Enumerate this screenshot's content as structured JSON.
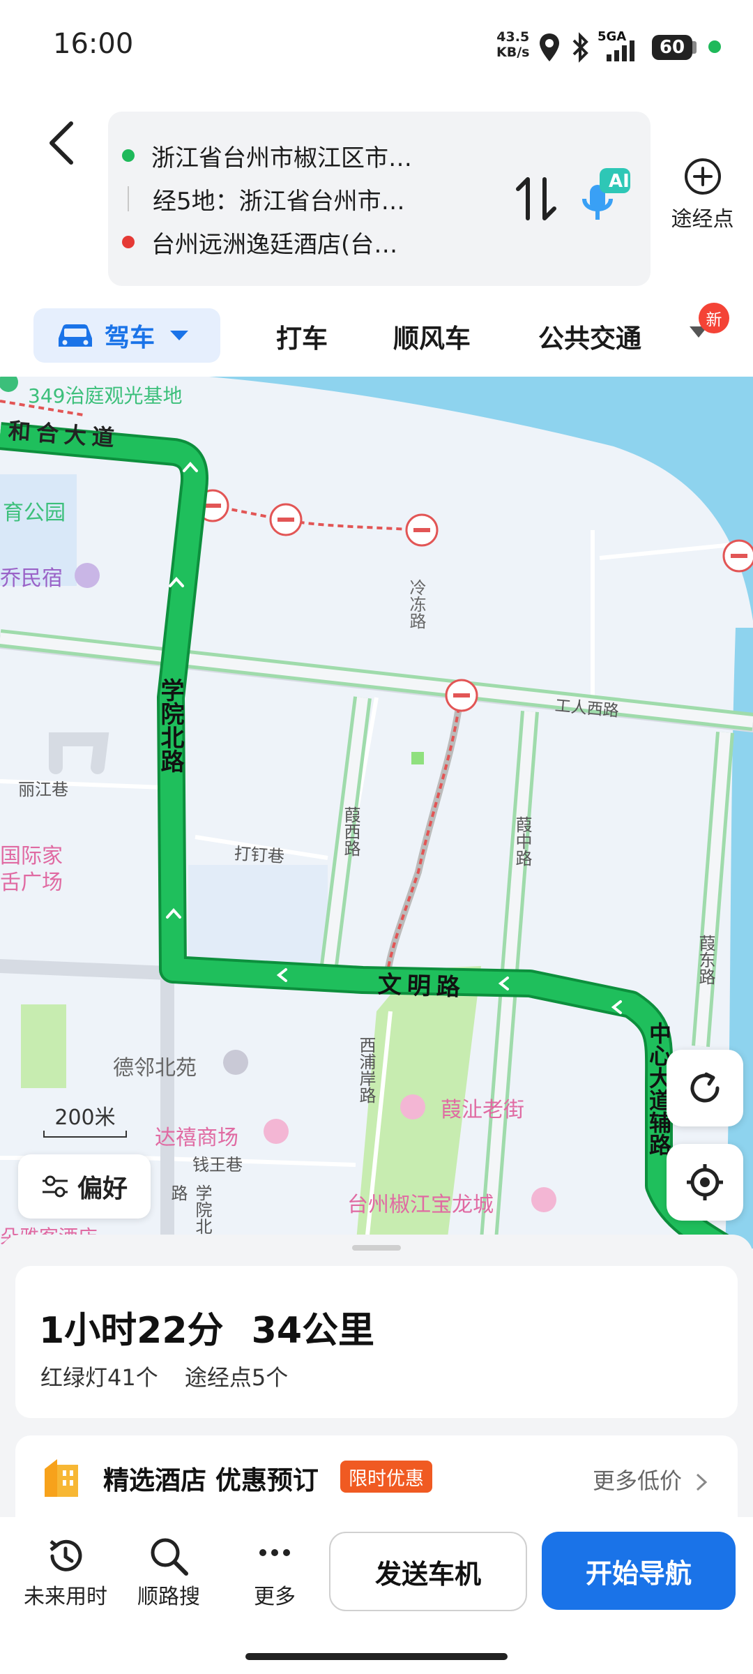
{
  "status_bar": {
    "time": "16:00",
    "net_speed_value": "43.5",
    "net_speed_unit": "KB/s",
    "signal_label": "5GA",
    "battery": "60"
  },
  "route": {
    "origin": "浙江省台州市椒江区市…",
    "via": "经5地：浙江省台州市…",
    "destination": "台州远洲逸廷酒店(台…",
    "waypoint_label": "途经点",
    "ai_label": "AI"
  },
  "tabs": {
    "drive": "驾车",
    "taxi": "打车",
    "carpool": "顺风车",
    "transit": "公共交通",
    "new_badge": "新"
  },
  "map": {
    "labels": {
      "top_poi": "349治庭观光基地",
      "road_hehe": "和合大道",
      "park": "育公园",
      "homestay": "乔民宿",
      "lengdong": "冷冻路",
      "gongren": "工人西路",
      "xueyuan": "学院北路",
      "lijiang": "丽江巷",
      "guoji_1": "国际家",
      "guoji_2": "舌广场",
      "dading": "打钉巷",
      "xiaxi": "葭西路",
      "xiazhong": "葭中路",
      "xiadong": "葭东路",
      "wenming": "文明路",
      "zhongxin": "中心大道辅路",
      "delin": "德邻北苑",
      "xipu": "西浦岸路",
      "laojie": "葭沚老街",
      "daxi": "达禧商场",
      "qianwang": "钱王巷",
      "baolong": "台州椒江宝龙城",
      "xueyuan2": "学院北路",
      "hotel_bottom": "朵雅客酒店"
    },
    "scale_label": "200米",
    "preference_label": "偏好"
  },
  "summary": {
    "duration": "1小时22分",
    "distance": "34公里",
    "lights": "红绿灯41个",
    "waypoints": "途经点5个"
  },
  "promo": {
    "title": "精选酒店 优惠预订",
    "tag": "限时优惠",
    "more": "更多低价"
  },
  "bottom": {
    "future": "未来用时",
    "along_search": "顺路搜",
    "more": "更多",
    "send_car": "发送车机",
    "start_nav": "开始导航"
  },
  "colors": {
    "accent": "#1a73e8",
    "route": "#1fb95a",
    "origin_dot": "#1fb95a",
    "dest_dot": "#e53935",
    "limit_tag": "#f05a22"
  }
}
